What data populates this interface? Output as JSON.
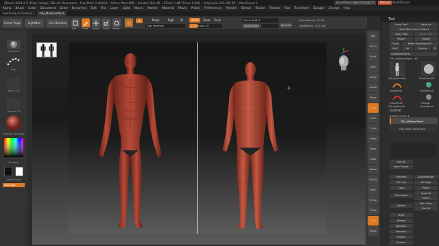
{
  "titlebar": {
    "title": "ZBrush 2021.6.6 [Pixel College]   ZBrush Document   • Free Mem 9.493GB • Active Mem 808 • Scratch Disk 45 • ZTime 2.487 Timer 0.009 • PolyCount 330.285 KP • MeshCount 2",
    "quicksave": "QuickSave",
    "see_through": "See-through 0",
    "menus": "Menus",
    "default_script": "DefaultZScript"
  },
  "menubar": [
    "Alpha",
    "Brush",
    "Color",
    "Document",
    "Draw",
    "Dynamics",
    "Edit",
    "File",
    "Layer",
    "Light",
    "Macro",
    "Marker",
    "Material",
    "Movie",
    "Picker",
    "Preferences",
    "Render",
    "Stencil",
    "Stroke",
    "Texture",
    "Tool",
    "Transform",
    "Zplugin",
    "Zscript",
    "Help"
  ],
  "statusbar": {
    "text": "Switching to Subtool 1",
    "tab": "OBJ_MyBaseMesh"
  },
  "shelf": {
    "home": "Home Page",
    "lightbox": "LightBox",
    "live_boolean": "Live Boolean",
    "tools": [
      "Edit",
      "Draw",
      "Move",
      "Scale",
      "Rotate"
    ],
    "a_label": "A",
    "mrgb": "Mrgb",
    "rgb": "Rgb",
    "m": "M",
    "zadd": "Zadd",
    "zsub": "Zsub",
    "zcut": "Zcut",
    "rgb_intensity": "Rgb Intensity",
    "z_intensity": "Z Intensity 25",
    "focal_shift": "Focal Shift 0",
    "draw_size": "Draw Size 64",
    "dynamic": "Dynamic",
    "active_points": "ActivePoints: 3,574",
    "total_points": "TotalPoints: 313,138"
  },
  "leftbar": {
    "brush": "Standard",
    "stroke": "Dots",
    "alpha": "Alpha Off",
    "texture": "Texture Off",
    "material": "MatCap Red Wax",
    "gradient": "Gradient",
    "switch_color": "SwitchColor",
    "alternate": "Alternate"
  },
  "navicons": [
    "BPR",
    "SPix 3",
    "Scroll",
    "Zoom",
    "Actual",
    "AAHalf",
    "Persp",
    "Floor",
    "Local",
    "L.Sym",
    "Frame",
    "Move",
    "Scale",
    "Rotate",
    "Line Fill",
    "PolyF",
    "Transp",
    "Ghost",
    "Solo",
    "Xpose"
  ],
  "rightpanel": {
    "title": "Tool",
    "load_tool": "Load Tool",
    "save_as": "Save As",
    "load_tools_from_project": "Load Tools From Project",
    "copy_tool": "Copy Tool",
    "paste_tool": "Paste Tool",
    "import": "Import",
    "export": "Export",
    "clone": "Clone",
    "make_polymesh": "Make PolyMesh3D",
    "goz": "GoZ",
    "all": "All",
    "visible": "Visible",
    "r": "R",
    "lightbox_tools": "Lightbox▸Tools",
    "current_tool": "OBJ_MyBaseMesh. 48",
    "thumbs": [
      "OBJ_MyBaseMes",
      "PolySphere3D",
      "AlphaBrush",
      "SimpleBrush",
      "EraserBrush",
      "Smudge",
      "OBJ_MyBaseMe",
      "SimpleBrush"
    ],
    "subtool_title": "Subtool",
    "visible_count": "Visible Count 4",
    "subtools": [
      "OBJ_MyBaseMesh",
      "OBJ_Male_Reference"
    ],
    "list_all": "List All",
    "new_folder": "New Folder",
    "rename": "Rename",
    "autoreorder": "AutoReorder",
    "all_low": "All Low",
    "all_high": "All High",
    "copy": "Copy",
    "paste": "Paste",
    "duplicate": "Duplicate",
    "append": "Append",
    "insert": "Insert",
    "delete": "Delete",
    "del_other": "Del Other",
    "del_all": "Del All",
    "split": "Split",
    "merge": "Merge",
    "boolean": "Boolean",
    "remesh": "Remesh",
    "project": "Project",
    "extract": "Extract"
  },
  "colors": {
    "accent": "#e07a22",
    "skin": "#b84a38",
    "menus": "#c04a2a"
  }
}
